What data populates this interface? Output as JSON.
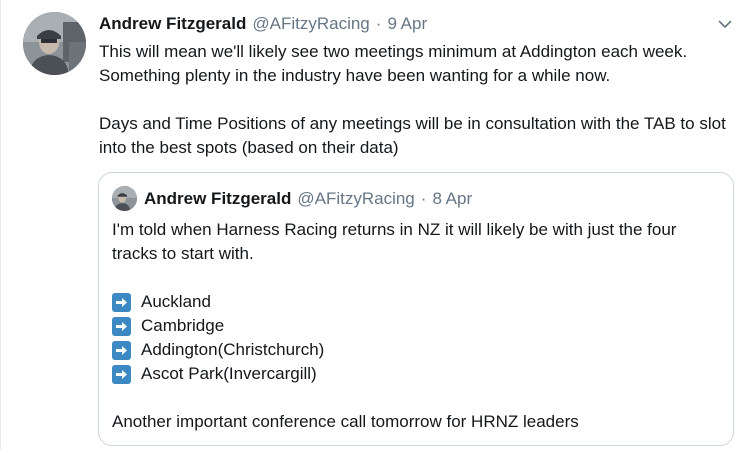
{
  "tweet": {
    "author_name": "Andrew Fitzgerald",
    "author_handle": "@AFitzyRacing",
    "separator": "·",
    "date": "9 Apr",
    "paragraphs": [
      "This will mean we'll likely see two meetings minimum at Addington each week. Something plenty in the industry have been wanting for a while now.",
      "Days and Time Positions of any meetings will be in consultation with the TAB to slot into the best spots (based on their data)"
    ],
    "menu_icon": "chevron-down-icon"
  },
  "quoted_tweet": {
    "author_name": "Andrew Fitzgerald",
    "author_handle": "@AFitzyRacing",
    "separator": "·",
    "date": "8 Apr",
    "intro": "I'm told when Harness Racing returns in NZ it will likely be with just the four tracks to start with.",
    "list_icon": "right-arrow-emoji-icon",
    "tracks": [
      "Auckland",
      "Cambridge",
      "Addington(Christchurch)",
      "Ascot Park(Invercargill)"
    ],
    "closing": "Another important conference call tomorrow for HRNZ leaders"
  },
  "colors": {
    "text": "#14171a",
    "secondary": "#657786",
    "border": "#ccd6dd",
    "arrow_emoji": "#3b88c3"
  }
}
